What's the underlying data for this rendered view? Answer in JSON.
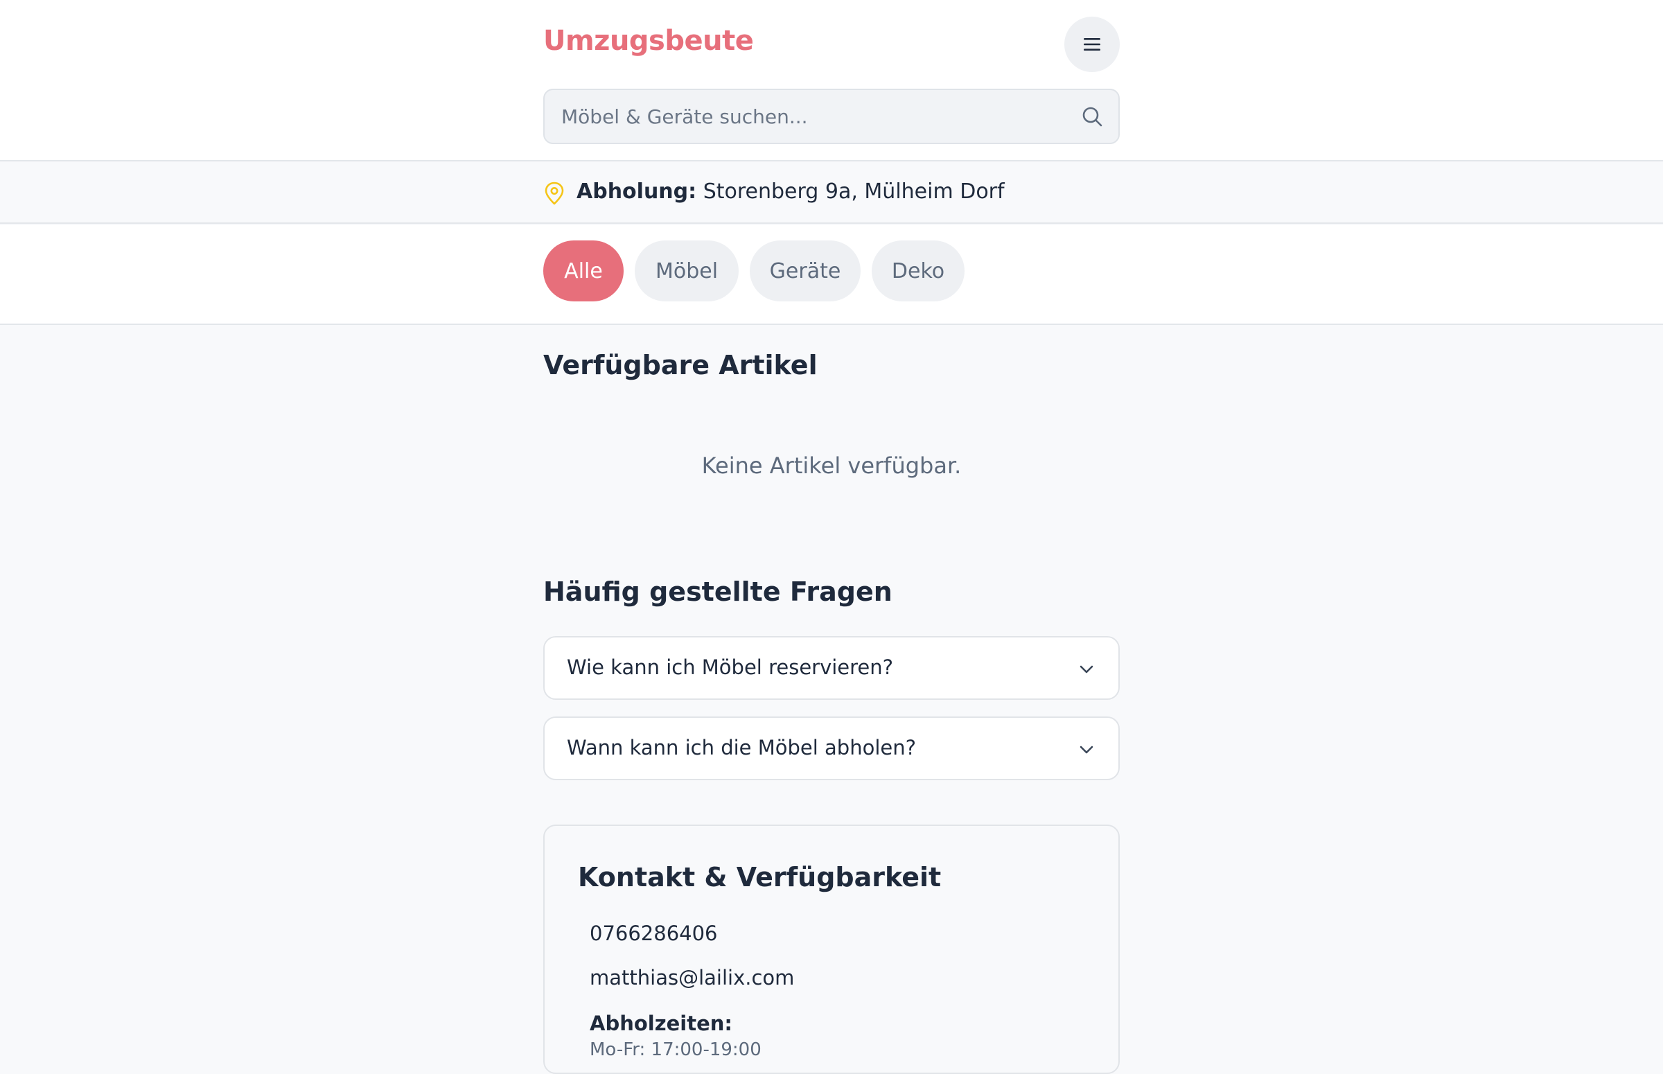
{
  "header": {
    "logo": "Umzugsbeute",
    "search_placeholder": "Möbel & Geräte suchen..."
  },
  "pickup": {
    "label": "Abholung:",
    "address": "Storenberg 9a, Mülheim Dorf"
  },
  "filters": [
    {
      "label": "Alle",
      "active": true
    },
    {
      "label": "Möbel",
      "active": false
    },
    {
      "label": "Geräte",
      "active": false
    },
    {
      "label": "Deko",
      "active": false
    }
  ],
  "items_section": {
    "title": "Verfügbare Artikel",
    "empty_text": "Keine Artikel verfügbar."
  },
  "faq": {
    "title": "Häufig gestellte Fragen",
    "questions": [
      "Wie kann ich Möbel reservieren?",
      "Wann kann ich die Möbel abholen?"
    ]
  },
  "contact": {
    "title": "Kontakt & Verfügbarkeit",
    "phone": "0766286406",
    "email": "matthias@lailix.com",
    "hours_label": "Abholzeiten:",
    "hours": "Mo-Fr: 17:00-19:00"
  },
  "colors": {
    "brand": "#e76f7b",
    "pin": "#f5c518",
    "text": "#1f2a3c",
    "muted": "#5d6a7c"
  }
}
